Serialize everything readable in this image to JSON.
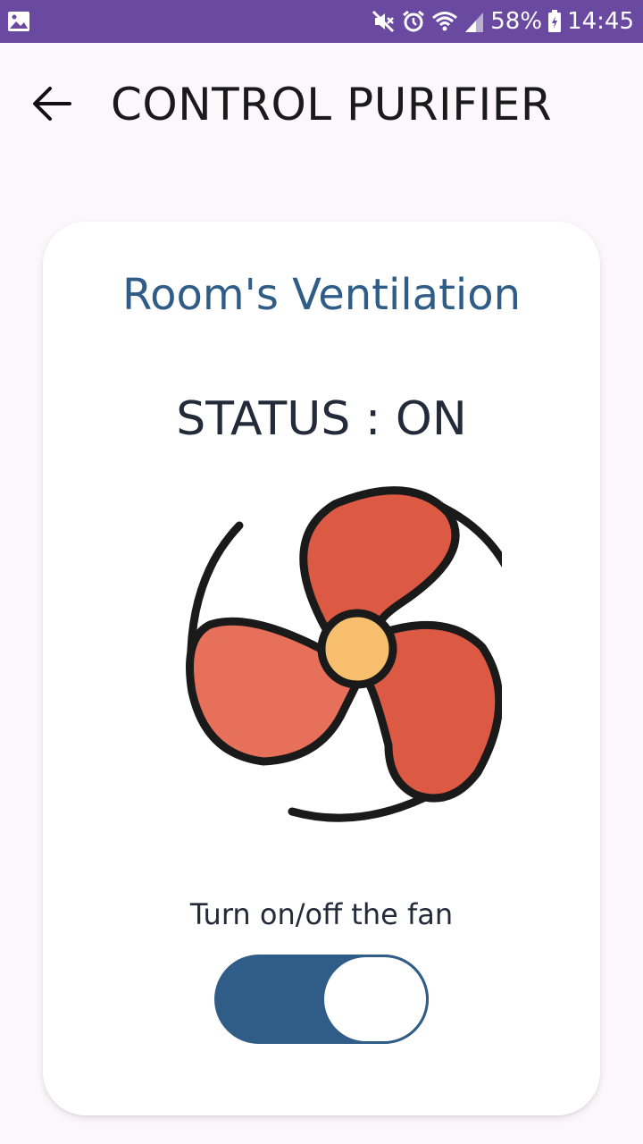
{
  "status_bar": {
    "battery": "58%",
    "time": "14:45",
    "icons": [
      "image-notification-icon",
      "mute-icon",
      "alarm-icon",
      "wifi-icon",
      "signal-icon",
      "battery-icon"
    ]
  },
  "header": {
    "title": "CONTROL PURIFIER",
    "back_icon": "arrow-left-icon"
  },
  "card": {
    "title": "Room's Ventilation",
    "status": "STATUS : ON",
    "fan_icon": "fan-icon",
    "toggle_label": "Turn on/off the fan",
    "toggle_on": true
  },
  "colors": {
    "status_bar": "#6a4aa0",
    "accent": "#2f5d87",
    "fan_blade": "#e0604a",
    "fan_hub": "#f7be6e"
  }
}
